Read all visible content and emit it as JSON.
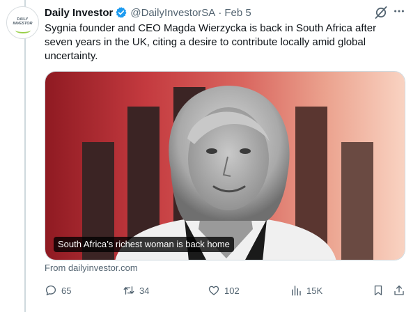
{
  "author": {
    "avatar_line1": "DAILY",
    "avatar_line2": "INVESTOR",
    "name": "Daily Investor",
    "handle": "@DailyInvestorSA",
    "separator": "·",
    "date": "Feb 5",
    "verified_icon": "verified-badge-icon"
  },
  "tweet": {
    "text": "Sygnia founder and CEO Magda Wierzycka is back in South Africa after seven years in the UK, citing a desire to contribute locally amid global uncertainty."
  },
  "card": {
    "caption": "South Africa’s richest woman is back home",
    "source": "From dailyinvestor.com",
    "colors": {
      "red_dark": "#8f1a22",
      "red_mid": "#c43a3f",
      "peach": "#f9d3c2",
      "bar": "#3b2424"
    }
  },
  "actions": {
    "replies": "65",
    "reposts": "34",
    "likes": "102",
    "views": "15K"
  },
  "colors": {
    "text": "#0f1419",
    "secondary": "#536471",
    "verified": "#1d9bf0",
    "border": "#cfd9de"
  }
}
